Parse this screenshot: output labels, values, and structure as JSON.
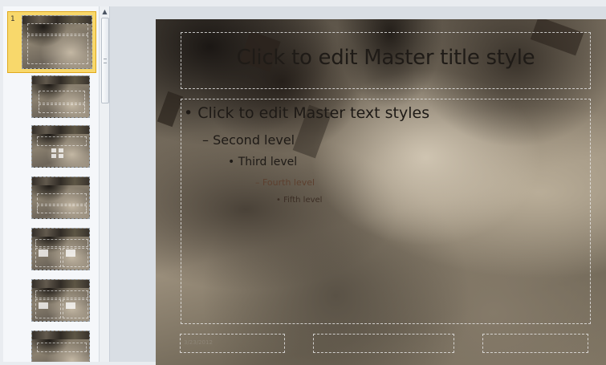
{
  "thumbnails": {
    "selected_number": "1"
  },
  "slide": {
    "title": "Click to edit Master title style",
    "levels": [
      "• Click to edit Master text styles",
      "– Second level",
      "• Third level",
      "– Fourth level",
      "• Fifth level"
    ],
    "date": "3/23/2012"
  },
  "colors": {
    "selection": "#f8d86b",
    "selection_border": "#e0a91c",
    "pane_background": "#f5f7fa",
    "editing_background": "#d9dee4"
  }
}
